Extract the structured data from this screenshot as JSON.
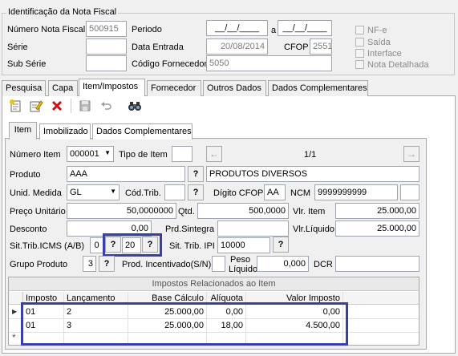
{
  "fiscal": {
    "legend": "Identificação da Nota Fiscal",
    "numero_label": "Número Nota Fiscal",
    "numero_value": "500915",
    "serie_label": "Série",
    "serie_value": "",
    "subserie_label": "Sub Série",
    "subserie_value": "",
    "periodo_label": "Periodo",
    "periodo_from": "__/__/____",
    "periodo_sep": "a",
    "periodo_to": "__/__/____",
    "data_entrada_label": "Data Entrada",
    "data_entrada_value": "20/08/2014",
    "cfop_label": "CFOP",
    "cfop_value": "2551",
    "cod_fornecedor_label": "Código Fornecedor",
    "cod_fornecedor_value": "5050",
    "checks": [
      "NF-e",
      "Saída",
      "Interface",
      "Nota Detalhada"
    ]
  },
  "main_tabs": [
    "Pesquisa",
    "Capa",
    "Item/Impostos",
    "Fornecedor",
    "Outros Dados",
    "Dados Complementares"
  ],
  "main_tab_selected": "Item/Impostos",
  "toolbar": [
    "new-icon",
    "edit-icon",
    "delete-icon",
    "save-icon",
    "undo-icon",
    "search-binoculars-icon"
  ],
  "sub_tabs": [
    "Item",
    "Imobilizado",
    "Dados Complementares"
  ],
  "sub_tab_selected": "Item",
  "item": {
    "numero_item_label": "Número Item",
    "numero_item_value": "000001",
    "tipo_item_label": "Tipo de Item",
    "tipo_item_value": "",
    "nav_prev": "←",
    "nav_next": "→",
    "position": "1/1",
    "produto_label": "Produto",
    "produto_code": "AAA",
    "produto_desc": "PRODUTOS DIVERSOS",
    "unid_label": "Unid. Medida",
    "unid_value": "GL",
    "cod_trib_label": "Cód.Trib.",
    "cod_trib_value": "",
    "digito_cfop_label": "Dígito CFOP",
    "digito_cfop_value": "AA",
    "ncm_label": "NCM",
    "ncm_value": "9999999999",
    "ncm_extra": "",
    "preco_label": "Preço Unitário",
    "preco_value": "50,0000000",
    "qtd_label": "Qtd.",
    "qtd_value": "500,0000",
    "vlr_item_label": "Vlr. Item",
    "vlr_item_value": "25.000,00",
    "desconto_label": "Desconto",
    "desconto_value": "0,00",
    "prod_sintegra_label": "Prd.Sintegra",
    "prod_sintegra_value": "",
    "vlr_liquido_label": "Vlr.Líquido",
    "vlr_liquido_value": "25.000,00",
    "sit_icms_label": "Sit.Trib.ICMS (A/B)",
    "sit_icms_a": "0",
    "sit_icms_b": "20",
    "sit_ipi_label": "Sit. Trib. IPI",
    "sit_ipi_value": "10000",
    "grupo_label": "Grupo Produto",
    "grupo_value": "3",
    "prod_incent_label": "Prod. Incentivado(S/N)",
    "prod_incent_value": "",
    "peso_label_1": "Peso",
    "peso_label_2": "Líquido",
    "peso_value": "0,000",
    "dcr_label": "DCR",
    "dcr_value": "",
    "q": "?"
  },
  "impostos": {
    "title": "Impostos Relacionados ao Item",
    "columns": [
      "Imposto",
      "Lançamento",
      "Base Cálculo",
      "Alíquota",
      "Valor Imposto"
    ],
    "rows": [
      [
        "01",
        "2",
        "25.000,00",
        "0,00",
        "0,00"
      ],
      [
        "01",
        "3",
        "25.000,00",
        "18,00",
        "4.500,00"
      ]
    ],
    "new_row_marker": "*"
  },
  "colors": {
    "highlight": "#3a3fa8",
    "selection_row": "#cfe0f6"
  }
}
